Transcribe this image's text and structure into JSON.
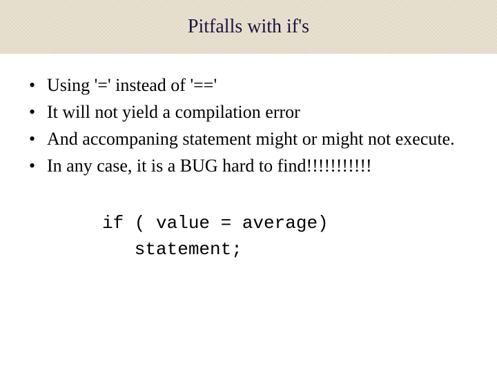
{
  "slide": {
    "title": "Pitfalls with if's",
    "bullets": [
      "Using '=' instead of '=='",
      "It will not yield a compilation error",
      "And accompaning statement might or might not execute.",
      "In any case, it is a BUG hard to find!!!!!!!!!!!"
    ],
    "code": {
      "line1": "if ( value = average)",
      "line2": "   statement;"
    }
  }
}
